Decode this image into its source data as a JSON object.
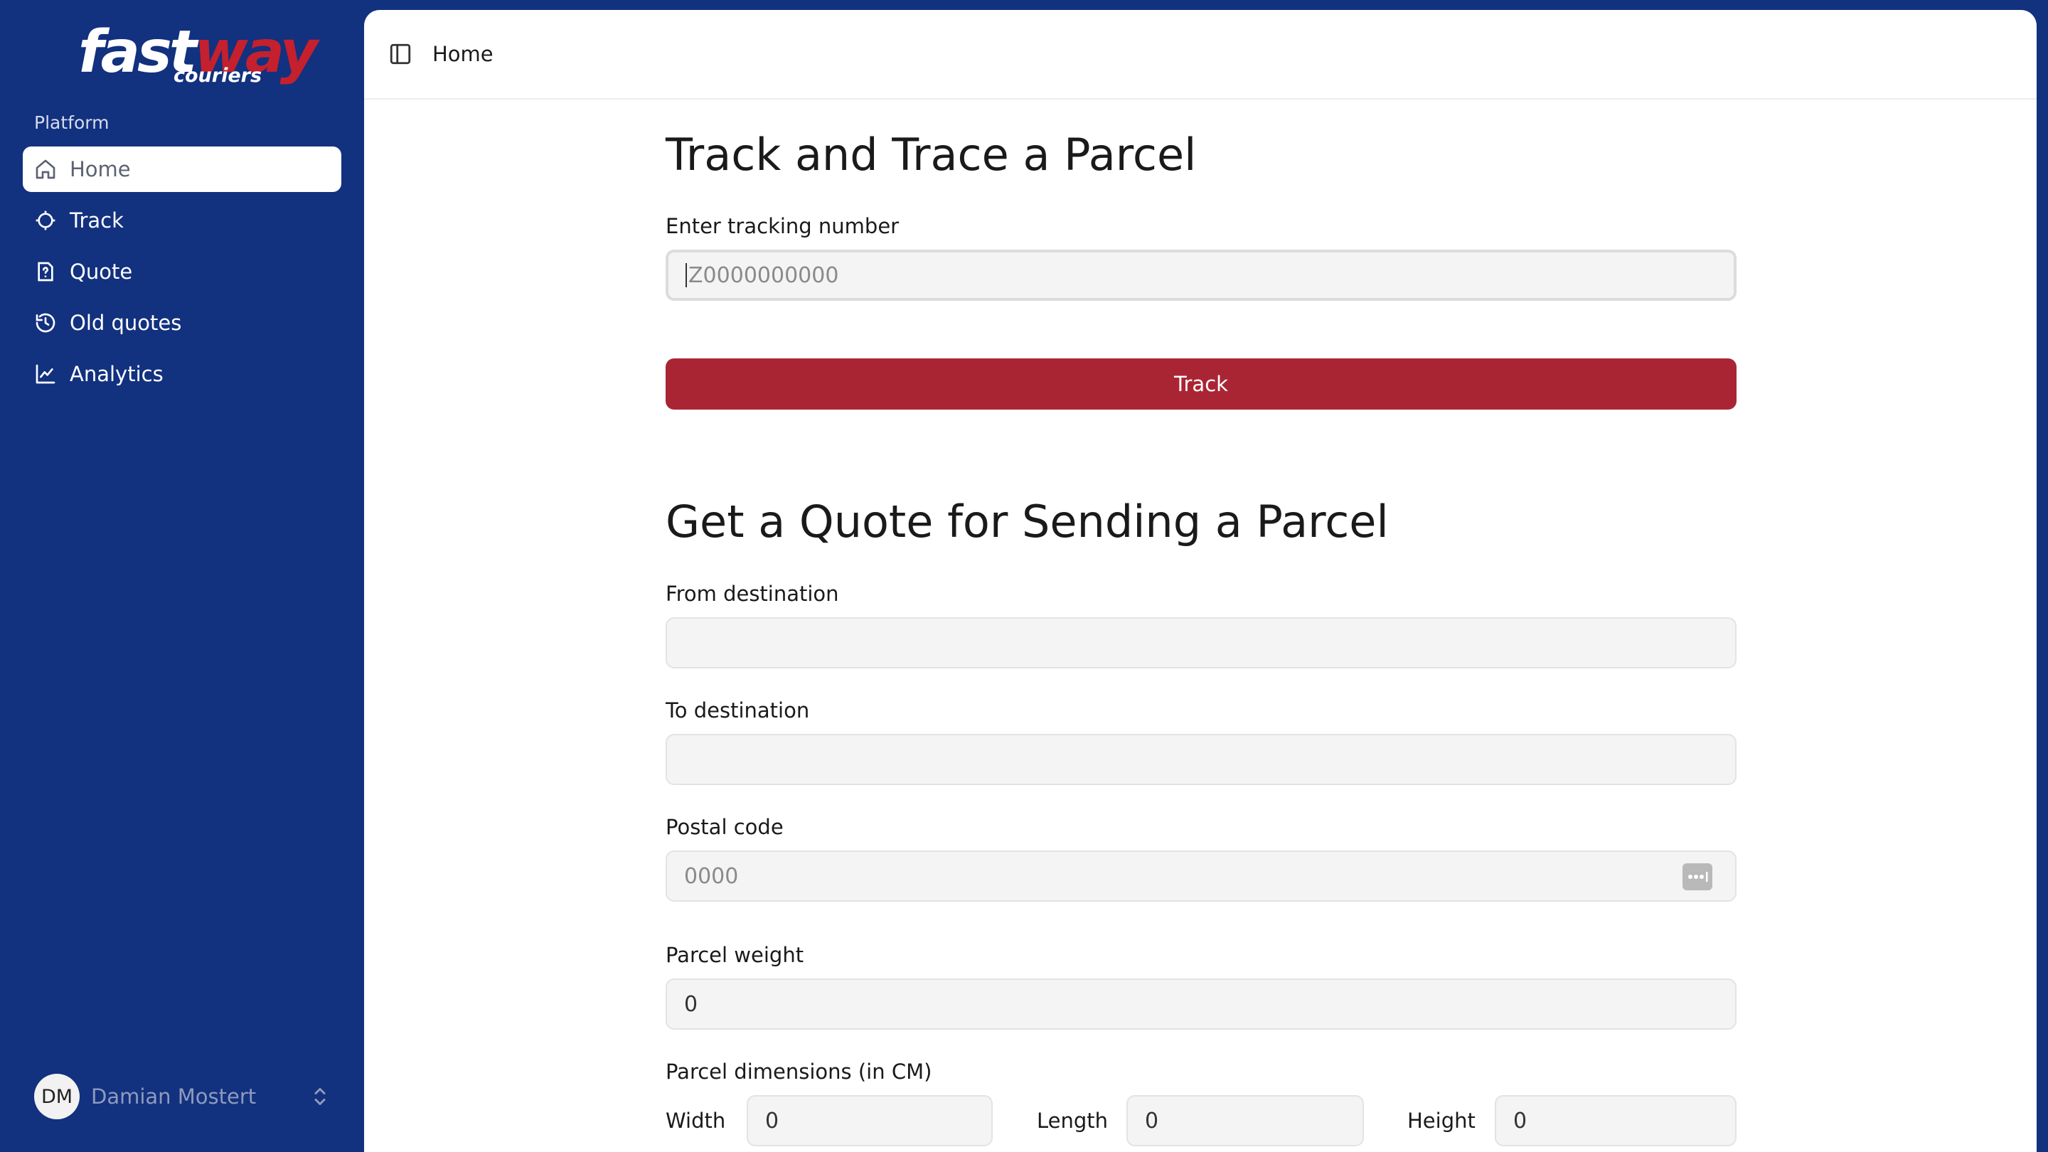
{
  "brand": {
    "logo_main": "fast",
    "logo_accent": "way",
    "logo_sub": "couriers"
  },
  "sidebar": {
    "section_label": "Platform",
    "items": [
      {
        "label": "Home",
        "icon": "home-icon",
        "active": true
      },
      {
        "label": "Track",
        "icon": "crosshair-icon",
        "active": false
      },
      {
        "label": "Quote",
        "icon": "quote-help-icon",
        "active": false
      },
      {
        "label": "Old quotes",
        "icon": "history-icon",
        "active": false
      },
      {
        "label": "Analytics",
        "icon": "chart-icon",
        "active": false
      }
    ],
    "user": {
      "initials": "DM",
      "name": "Damian Mostert"
    }
  },
  "header": {
    "breadcrumb": "Home"
  },
  "track": {
    "title": "Track and Trace a Parcel",
    "label": "Enter tracking number",
    "placeholder": "Z0000000000",
    "button": "Track"
  },
  "quote": {
    "title": "Get a Quote for Sending a Parcel",
    "from_label": "From destination",
    "from_value": "",
    "to_label": "To destination",
    "to_value": "",
    "postal_label": "Postal code",
    "postal_placeholder": "0000",
    "weight_label": "Parcel weight",
    "weight_value": "0",
    "dims_label": "Parcel dimensions (in CM)",
    "width_label": "Width",
    "width_value": "0",
    "length_label": "Length",
    "length_value": "0",
    "height_label": "Height",
    "height_value": "0"
  },
  "colors": {
    "sidebar_bg": "#12317f",
    "brand_red": "#aa2534",
    "input_bg": "#f4f4f4"
  }
}
